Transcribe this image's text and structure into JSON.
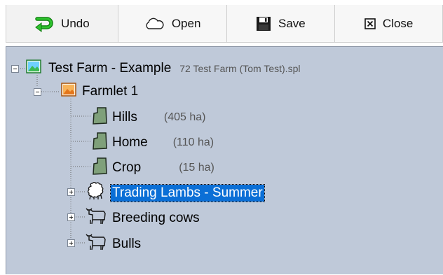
{
  "toolbar": {
    "undo_label": "Undo",
    "open_label": "Open",
    "save_label": "Save",
    "close_label": "Close"
  },
  "tree": {
    "root": {
      "label": "Test Farm - Example",
      "file": "72 Test Farm (Tom Test).spl",
      "icon": "farm-map-icon",
      "expanded": true
    },
    "farmlet": {
      "label": "Farmlet 1",
      "icon": "farmlet-map-icon",
      "expanded": true
    },
    "paddocks": [
      {
        "label": "Hills",
        "area": "(405 ha)",
        "icon": "paddock-icon"
      },
      {
        "label": "Home",
        "area": "(110 ha)",
        "icon": "paddock-icon"
      },
      {
        "label": "Crop",
        "area": "(15 ha)",
        "icon": "paddock-icon"
      }
    ],
    "mobs": [
      {
        "label": "Trading Lambs - Summer",
        "icon": "sheep-icon",
        "selected": true,
        "expanded": false
      },
      {
        "label": "Breeding cows",
        "icon": "cow-icon",
        "selected": false,
        "expanded": false
      },
      {
        "label": "Bulls",
        "icon": "cow-icon",
        "selected": false,
        "expanded": false
      }
    ]
  },
  "colors": {
    "panel_bg": "#bfc9d9",
    "selection_bg": "#0b6fd6",
    "paddock_fill": "#7fa07a",
    "farm_icon_green": "#3cba54",
    "farmlet_icon_orange": "#f08a24",
    "undo_arrow_green": "#1aa31a"
  }
}
